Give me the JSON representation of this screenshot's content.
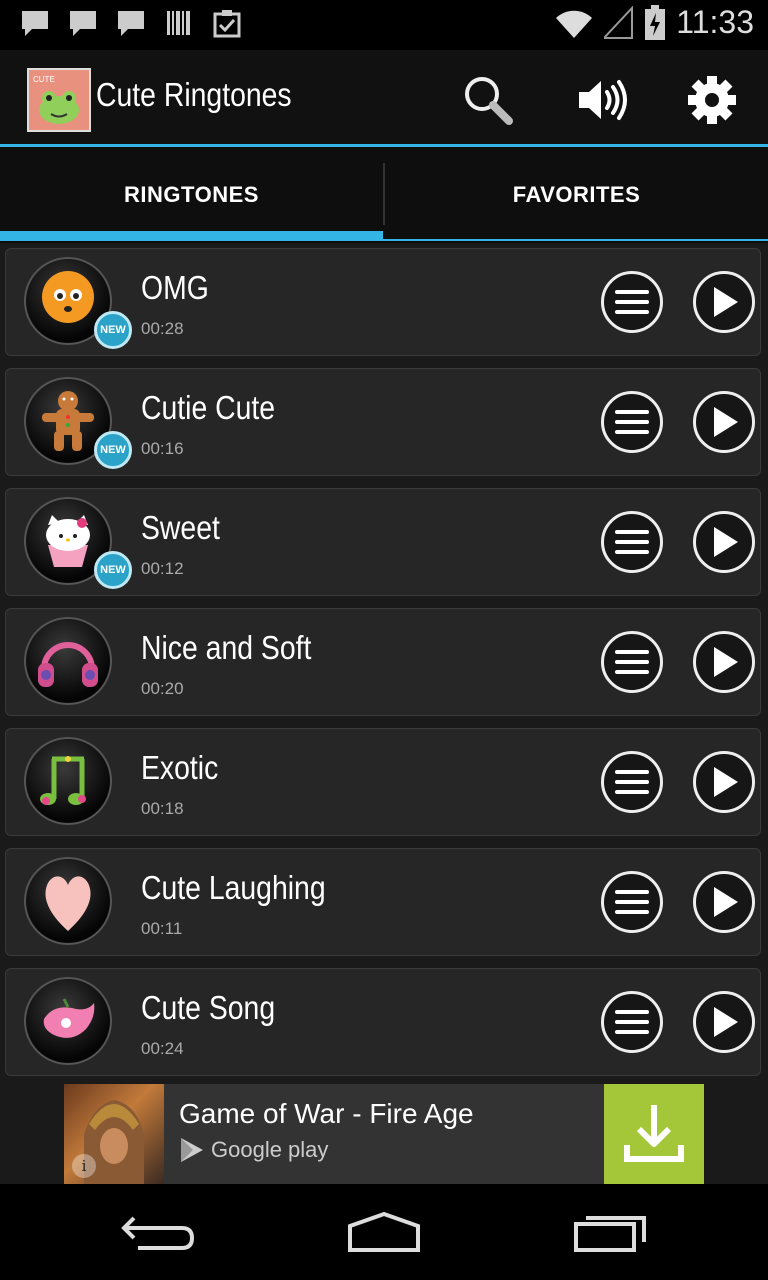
{
  "status_bar": {
    "time": "11:33",
    "notification_icons": [
      "chat-icon",
      "chat-icon",
      "chat-icon",
      "barcode-icon",
      "clipboard-check-icon"
    ],
    "right_icons": [
      "wifi-icon",
      "signal-icon",
      "battery-charging-icon"
    ]
  },
  "action_bar": {
    "title": "Cute Ringtones",
    "icon_label": "CUTE",
    "actions": [
      "search-icon",
      "volume-icon",
      "settings-icon"
    ]
  },
  "tabs": [
    {
      "label": "RINGTONES",
      "selected": true
    },
    {
      "label": "FAVORITES",
      "selected": false
    }
  ],
  "ringtones": [
    {
      "name": "OMG",
      "duration": "00:28",
      "badge": "NEW",
      "thumb": "orange-smiley-icon"
    },
    {
      "name": "Cutie Cute",
      "duration": "00:16",
      "badge": "NEW",
      "thumb": "gingerbread-man-icon"
    },
    {
      "name": "Sweet",
      "duration": "00:12",
      "badge": "NEW",
      "thumb": "kitty-cupcake-icon"
    },
    {
      "name": "Nice and Soft",
      "duration": "00:20",
      "badge": "",
      "thumb": "pink-headphones-icon"
    },
    {
      "name": "Exotic",
      "duration": "00:18",
      "badge": "",
      "thumb": "music-note-flowers-icon"
    },
    {
      "name": "Cute Laughing",
      "duration": "00:11",
      "badge": "",
      "thumb": "pink-heart-icon"
    },
    {
      "name": "Cute Song",
      "duration": "00:24",
      "badge": "",
      "thumb": "pink-bird-icon"
    }
  ],
  "ad": {
    "title": "Game of War - Fire Age",
    "store": "Google play",
    "info_glyph": "i",
    "colors": {
      "download_bg": "#a4c639"
    }
  },
  "nav_bar": [
    "back-icon",
    "home-icon",
    "recents-icon"
  ],
  "colors": {
    "accent": "#33b5e5",
    "badge": "#2ba3c8"
  }
}
